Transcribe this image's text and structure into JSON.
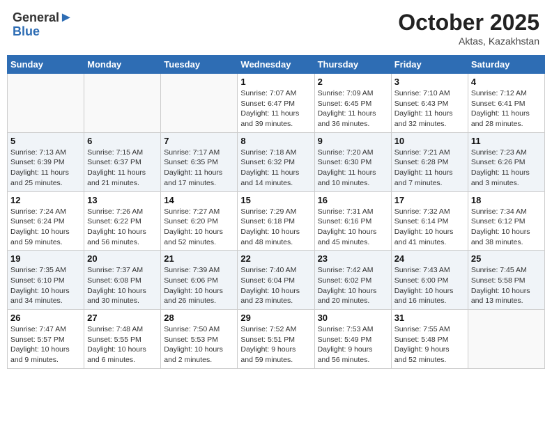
{
  "header": {
    "logo_line1": "General",
    "logo_line2": "Blue",
    "month_title": "October 2025",
    "location": "Aktas, Kazakhstan"
  },
  "weekdays": [
    "Sunday",
    "Monday",
    "Tuesday",
    "Wednesday",
    "Thursday",
    "Friday",
    "Saturday"
  ],
  "weeks": [
    [
      {
        "day": "",
        "info": ""
      },
      {
        "day": "",
        "info": ""
      },
      {
        "day": "",
        "info": ""
      },
      {
        "day": "1",
        "info": "Sunrise: 7:07 AM\nSunset: 6:47 PM\nDaylight: 11 hours\nand 39 minutes."
      },
      {
        "day": "2",
        "info": "Sunrise: 7:09 AM\nSunset: 6:45 PM\nDaylight: 11 hours\nand 36 minutes."
      },
      {
        "day": "3",
        "info": "Sunrise: 7:10 AM\nSunset: 6:43 PM\nDaylight: 11 hours\nand 32 minutes."
      },
      {
        "day": "4",
        "info": "Sunrise: 7:12 AM\nSunset: 6:41 PM\nDaylight: 11 hours\nand 28 minutes."
      }
    ],
    [
      {
        "day": "5",
        "info": "Sunrise: 7:13 AM\nSunset: 6:39 PM\nDaylight: 11 hours\nand 25 minutes."
      },
      {
        "day": "6",
        "info": "Sunrise: 7:15 AM\nSunset: 6:37 PM\nDaylight: 11 hours\nand 21 minutes."
      },
      {
        "day": "7",
        "info": "Sunrise: 7:17 AM\nSunset: 6:35 PM\nDaylight: 11 hours\nand 17 minutes."
      },
      {
        "day": "8",
        "info": "Sunrise: 7:18 AM\nSunset: 6:32 PM\nDaylight: 11 hours\nand 14 minutes."
      },
      {
        "day": "9",
        "info": "Sunrise: 7:20 AM\nSunset: 6:30 PM\nDaylight: 11 hours\nand 10 minutes."
      },
      {
        "day": "10",
        "info": "Sunrise: 7:21 AM\nSunset: 6:28 PM\nDaylight: 11 hours\nand 7 minutes."
      },
      {
        "day": "11",
        "info": "Sunrise: 7:23 AM\nSunset: 6:26 PM\nDaylight: 11 hours\nand 3 minutes."
      }
    ],
    [
      {
        "day": "12",
        "info": "Sunrise: 7:24 AM\nSunset: 6:24 PM\nDaylight: 10 hours\nand 59 minutes."
      },
      {
        "day": "13",
        "info": "Sunrise: 7:26 AM\nSunset: 6:22 PM\nDaylight: 10 hours\nand 56 minutes."
      },
      {
        "day": "14",
        "info": "Sunrise: 7:27 AM\nSunset: 6:20 PM\nDaylight: 10 hours\nand 52 minutes."
      },
      {
        "day": "15",
        "info": "Sunrise: 7:29 AM\nSunset: 6:18 PM\nDaylight: 10 hours\nand 48 minutes."
      },
      {
        "day": "16",
        "info": "Sunrise: 7:31 AM\nSunset: 6:16 PM\nDaylight: 10 hours\nand 45 minutes."
      },
      {
        "day": "17",
        "info": "Sunrise: 7:32 AM\nSunset: 6:14 PM\nDaylight: 10 hours\nand 41 minutes."
      },
      {
        "day": "18",
        "info": "Sunrise: 7:34 AM\nSunset: 6:12 PM\nDaylight: 10 hours\nand 38 minutes."
      }
    ],
    [
      {
        "day": "19",
        "info": "Sunrise: 7:35 AM\nSunset: 6:10 PM\nDaylight: 10 hours\nand 34 minutes."
      },
      {
        "day": "20",
        "info": "Sunrise: 7:37 AM\nSunset: 6:08 PM\nDaylight: 10 hours\nand 30 minutes."
      },
      {
        "day": "21",
        "info": "Sunrise: 7:39 AM\nSunset: 6:06 PM\nDaylight: 10 hours\nand 26 minutes."
      },
      {
        "day": "22",
        "info": "Sunrise: 7:40 AM\nSunset: 6:04 PM\nDaylight: 10 hours\nand 23 minutes."
      },
      {
        "day": "23",
        "info": "Sunrise: 7:42 AM\nSunset: 6:02 PM\nDaylight: 10 hours\nand 20 minutes."
      },
      {
        "day": "24",
        "info": "Sunrise: 7:43 AM\nSunset: 6:00 PM\nDaylight: 10 hours\nand 16 minutes."
      },
      {
        "day": "25",
        "info": "Sunrise: 7:45 AM\nSunset: 5:58 PM\nDaylight: 10 hours\nand 13 minutes."
      }
    ],
    [
      {
        "day": "26",
        "info": "Sunrise: 7:47 AM\nSunset: 5:57 PM\nDaylight: 10 hours\nand 9 minutes."
      },
      {
        "day": "27",
        "info": "Sunrise: 7:48 AM\nSunset: 5:55 PM\nDaylight: 10 hours\nand 6 minutes."
      },
      {
        "day": "28",
        "info": "Sunrise: 7:50 AM\nSunset: 5:53 PM\nDaylight: 10 hours\nand 2 minutes."
      },
      {
        "day": "29",
        "info": "Sunrise: 7:52 AM\nSunset: 5:51 PM\nDaylight: 9 hours\nand 59 minutes."
      },
      {
        "day": "30",
        "info": "Sunrise: 7:53 AM\nSunset: 5:49 PM\nDaylight: 9 hours\nand 56 minutes."
      },
      {
        "day": "31",
        "info": "Sunrise: 7:55 AM\nSunset: 5:48 PM\nDaylight: 9 hours\nand 52 minutes."
      },
      {
        "day": "",
        "info": ""
      }
    ]
  ]
}
